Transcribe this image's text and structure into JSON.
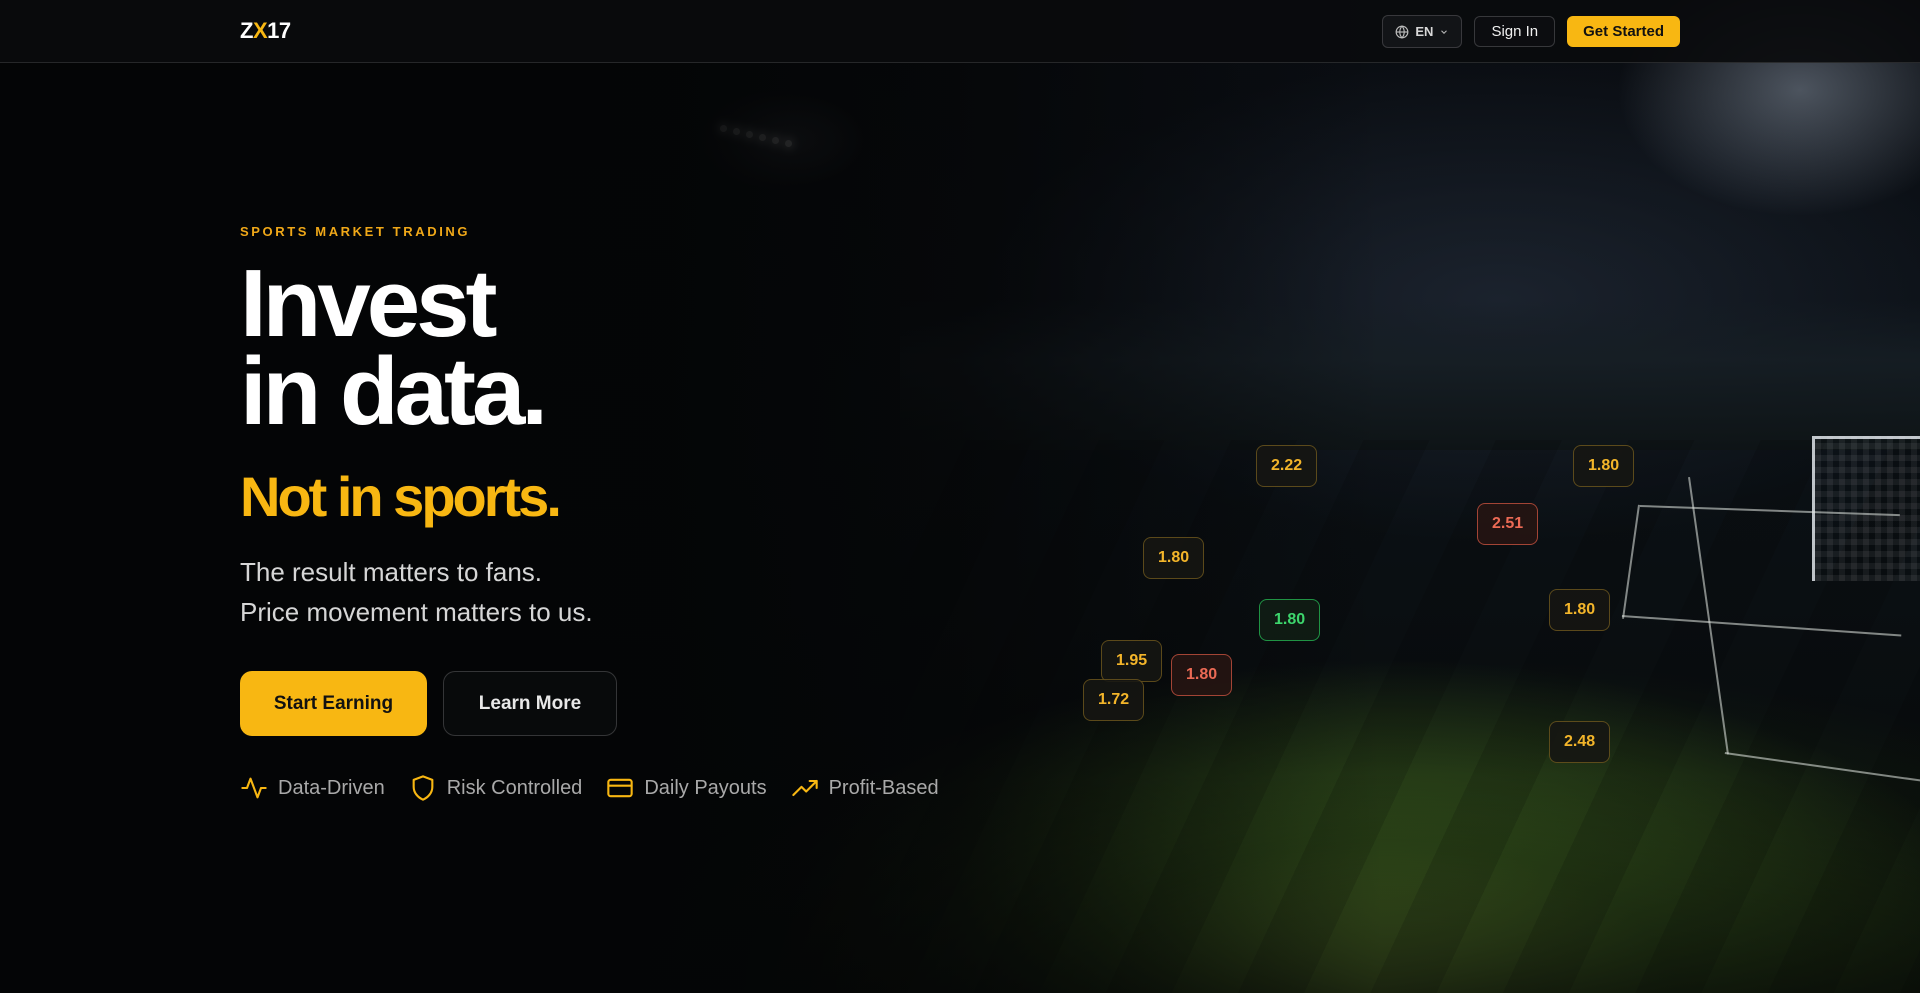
{
  "header": {
    "logo_prefix": "Z",
    "logo_accent": "X",
    "logo_suffix": "17",
    "language": "EN",
    "sign_in_label": "Sign In",
    "get_started_label": "Get Started"
  },
  "hero": {
    "eyebrow": "SPORTS MARKET TRADING",
    "headline_line1": "Invest",
    "headline_line2": "in data.",
    "subheadline": "Not in sports.",
    "tagline_line1": "The result matters to fans.",
    "tagline_line2": "Price movement matters to us.",
    "primary_cta": "Start Earning",
    "secondary_cta": "Learn More",
    "features": [
      {
        "icon": "activity-icon",
        "label": "Data-Driven"
      },
      {
        "icon": "shield-icon",
        "label": "Risk Controlled"
      },
      {
        "icon": "credit-card-icon",
        "label": "Daily Payouts"
      },
      {
        "icon": "trending-up-icon",
        "label": "Profit-Based"
      }
    ]
  },
  "odds": [
    {
      "value": "2.22",
      "state": "neutral"
    },
    {
      "value": "1.80",
      "state": "neutral"
    },
    {
      "value": "2.51",
      "state": "down"
    },
    {
      "value": "1.80",
      "state": "neutral"
    },
    {
      "value": "1.80",
      "state": "up"
    },
    {
      "value": "1.80",
      "state": "neutral"
    },
    {
      "value": "1.95",
      "state": "neutral"
    },
    {
      "value": "1.80",
      "state": "down"
    },
    {
      "value": "1.72",
      "state": "neutral"
    },
    {
      "value": "2.48",
      "state": "neutral"
    }
  ],
  "colors": {
    "accent": "#f8b712",
    "background": "#050608",
    "odds_up": "#3dd66d",
    "odds_down": "#ec6a55"
  }
}
